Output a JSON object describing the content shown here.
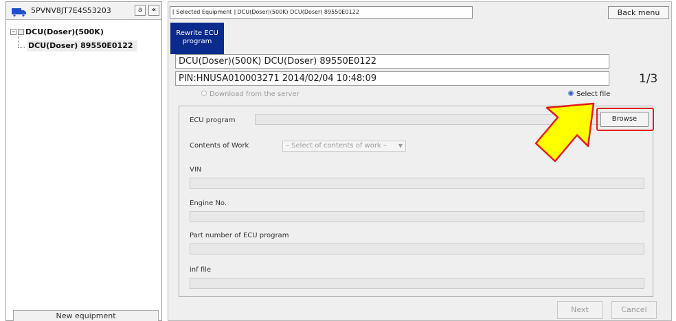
{
  "equipment": {
    "serial": "5PVNV8JT7E4S53203",
    "a_button": "a",
    "collapse_button": "«"
  },
  "tree": {
    "toggle": "−",
    "root_label": "DCU(Doser)(500K)",
    "child_label": "DCU(Doser) 89550E0122"
  },
  "left_footer": {
    "new_equipment_label": "New equipment"
  },
  "header": {
    "selected_equipment": "[ Selected Equipment ] DCU(Doser)(500K) DCU(Doser) 89550E0122",
    "back_menu_label": "Back menu"
  },
  "tab": {
    "line1": "Rewrite ECU",
    "line2": "program"
  },
  "info": {
    "equipment_line": "DCU(Doser)(500K) DCU(Doser) 89550E0122",
    "pin_line": "PIN:HNUSA010003271 2014/02/04 10:48:09",
    "step": "1/3"
  },
  "source": {
    "download_label": "Download from the server",
    "select_file_label": "Select file",
    "selected": "select_file"
  },
  "form": {
    "ecu_program_label": "ECU program",
    "ecu_program_value": "",
    "browse_label": "Browse",
    "contents_of_work_label": "Contents of Work",
    "contents_of_work_value": "– Select of contents of work –",
    "vin_label": "VIN",
    "vin_value": "",
    "engine_no_label": "Engine No.",
    "engine_no_value": "",
    "part_number_label": "Part number of ECU program",
    "part_number_value": "",
    "inf_file_label": "inf file",
    "inf_file_value": ""
  },
  "footer": {
    "next_label": "Next",
    "cancel_label": "Cancel"
  },
  "colors": {
    "tab_bg": "#0a2a8c",
    "highlight": "#e11b1b",
    "arrow_fill": "#ffff00",
    "arrow_stroke": "#e11b1b"
  }
}
